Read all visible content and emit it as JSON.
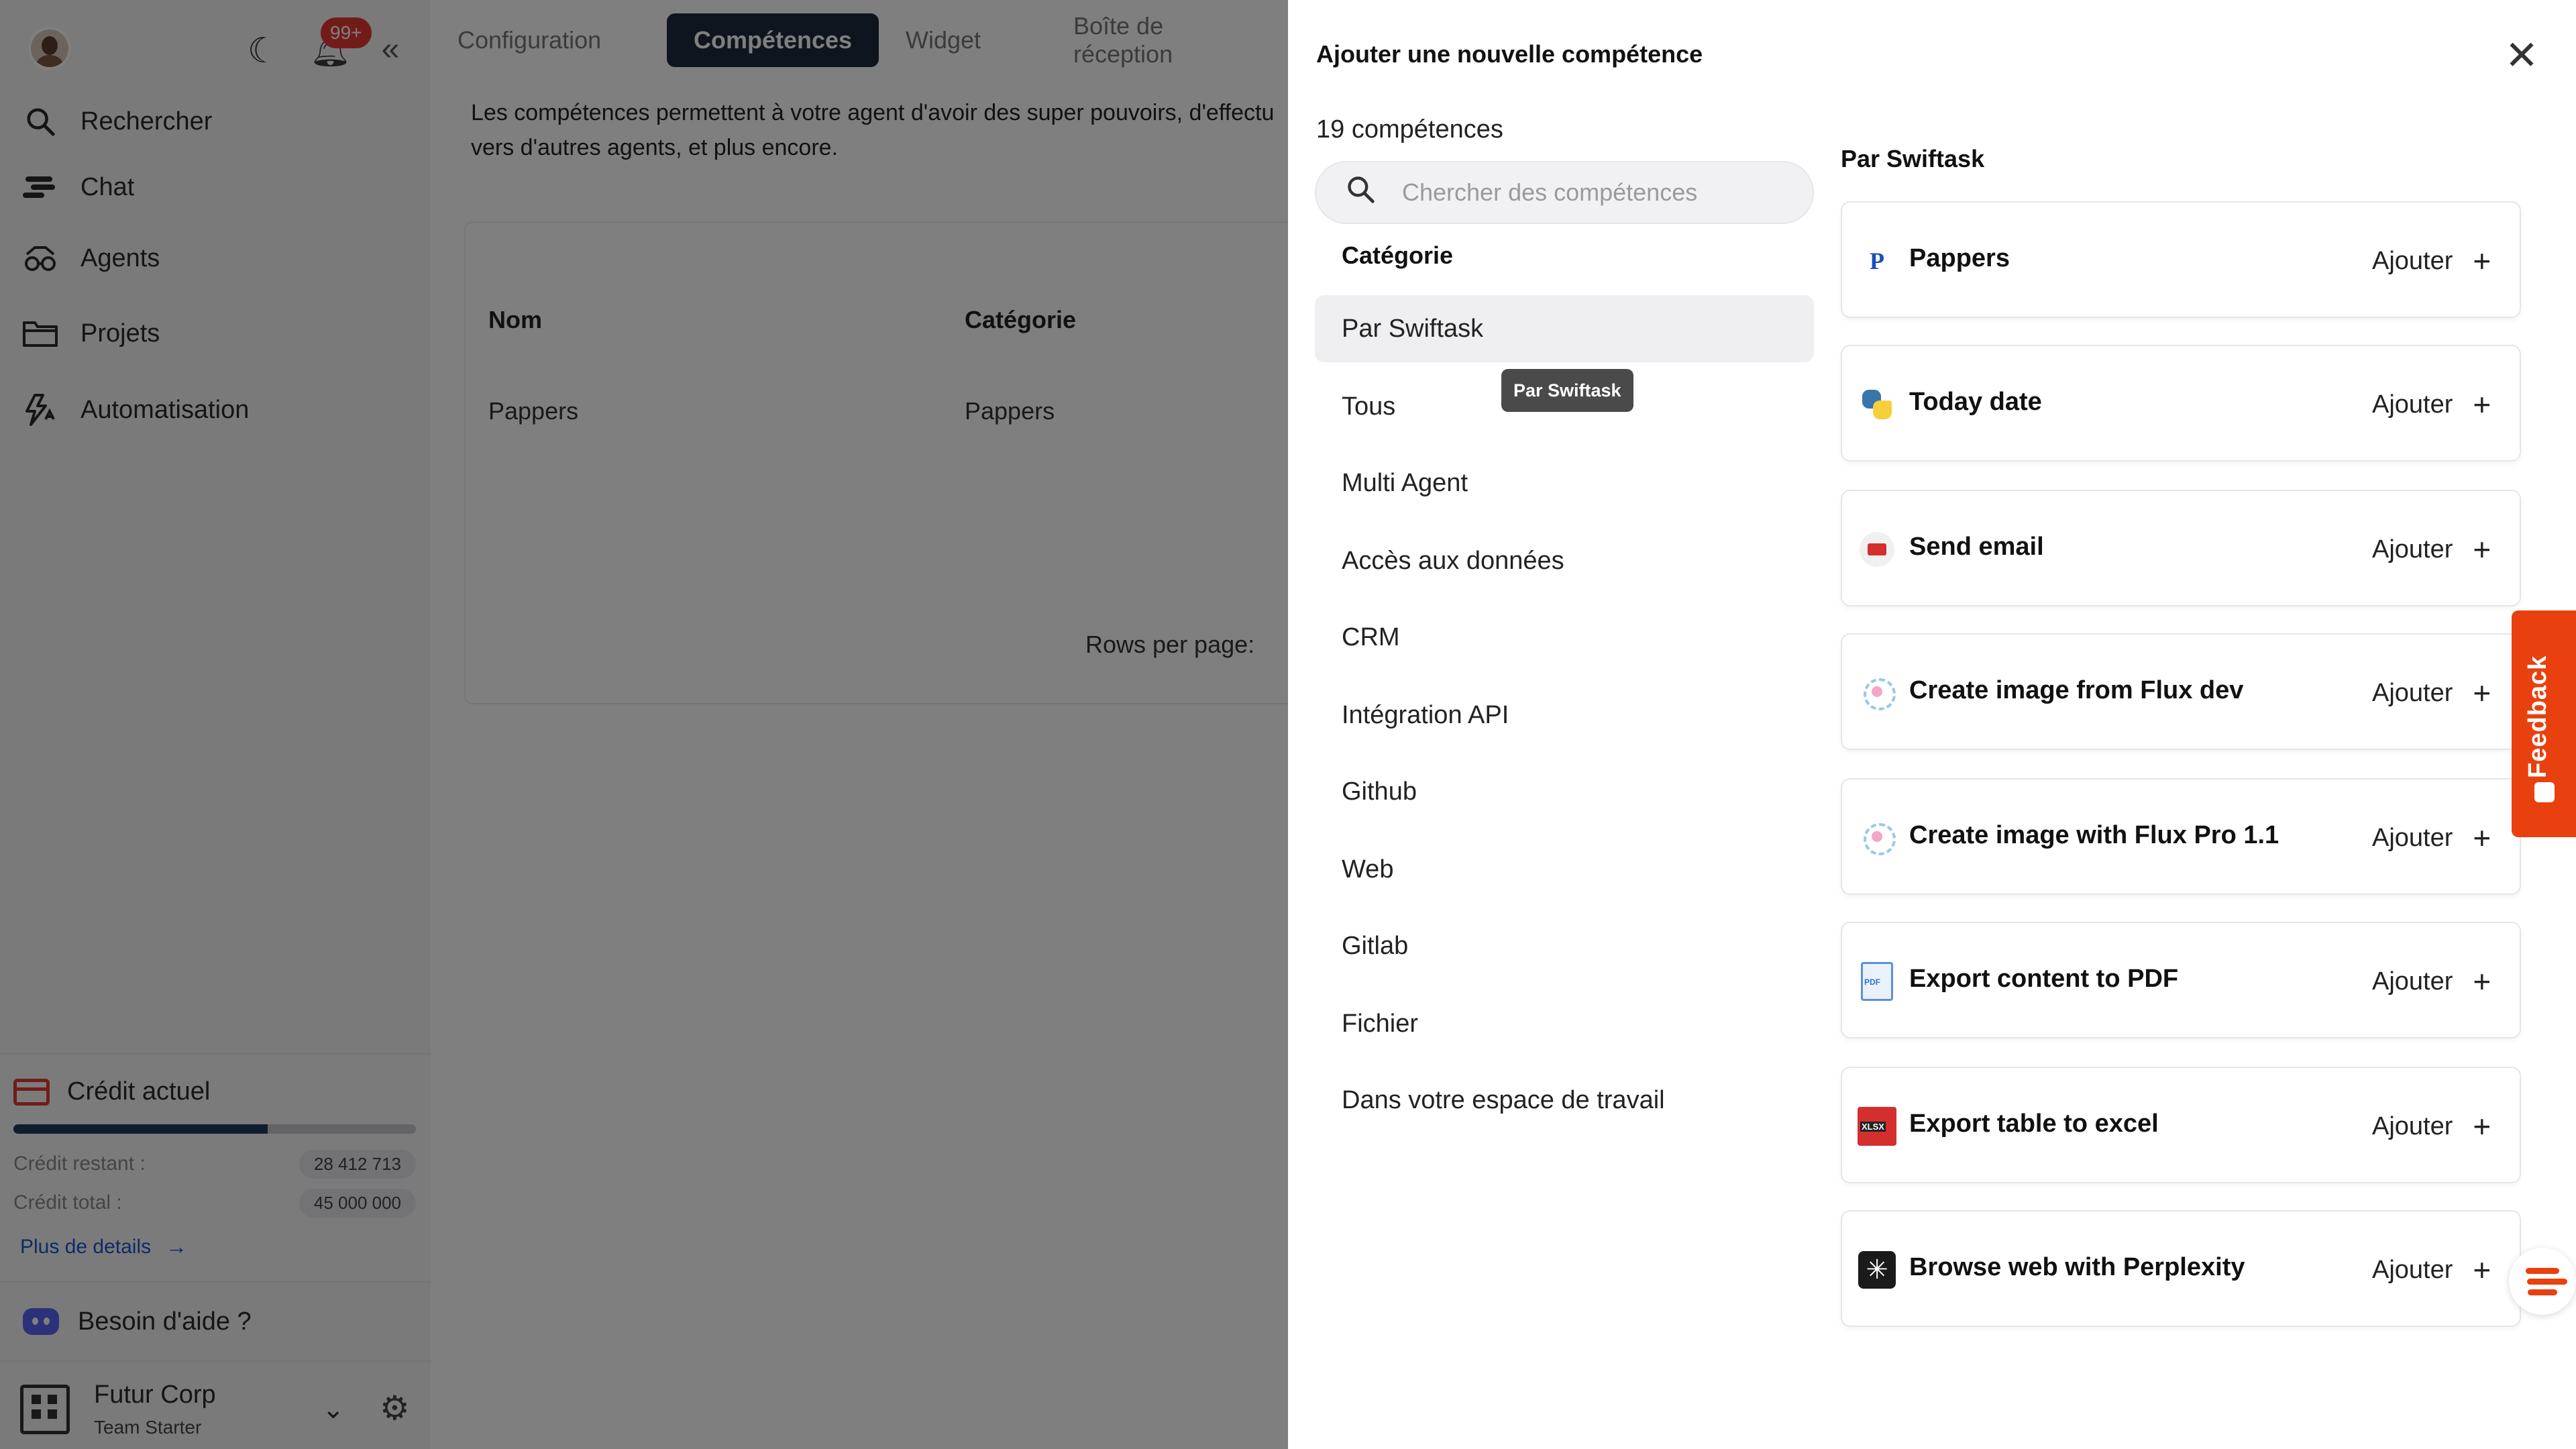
{
  "sidebar": {
    "notifications_badge": "99+",
    "nav": [
      {
        "label": "Rechercher",
        "icon": "search-icon"
      },
      {
        "label": "Chat",
        "icon": "chat-icon"
      },
      {
        "label": "Agents",
        "icon": "agents-icon"
      },
      {
        "label": "Projets",
        "icon": "folder-icon"
      },
      {
        "label": "Automatisation",
        "icon": "automation-icon"
      }
    ],
    "credit": {
      "title": "Crédit actuel",
      "remaining_label": "Crédit restant :",
      "remaining_value": "28 412 713",
      "total_label": "Crédit total :",
      "total_value": "45 000 000",
      "remaining_fraction": 0.631,
      "details_link": "Plus de details"
    },
    "help": "Besoin d'aide ?",
    "org": {
      "name": "Futur Corp",
      "plan": "Team Starter"
    }
  },
  "main": {
    "tabs": [
      "Configuration",
      "Compétences",
      "Widget",
      "Boîte de réception"
    ],
    "active_tab": "Compétences",
    "description_line1": "Les compétences permettent à votre agent d'avoir des super pouvoirs, d'effectu",
    "description_line2": "vers d'autres agents, et plus encore.",
    "table": {
      "headers": [
        "Nom",
        "Catégorie"
      ],
      "rows": [
        [
          "Pappers",
          "Pappers"
        ]
      ],
      "rows_per_page_label": "Rows per page:"
    }
  },
  "panel": {
    "title": "Ajouter une nouvelle compétence",
    "count": "19 compétences",
    "search_placeholder": "Chercher des compétences",
    "category_heading": "Catégorie",
    "categories": [
      "Par Swiftask",
      "Tous",
      "Multi Agent",
      "Accès aux données",
      "CRM",
      "Intégration API",
      "Github",
      "Web",
      "Gitlab",
      "Fichier",
      "Dans votre espace de travail"
    ],
    "active_category": "Par Swiftask",
    "tooltip": "Par Swiftask",
    "group_title": "Par Swiftask",
    "add_label": "Ajouter",
    "skills": [
      {
        "name": "Pappers",
        "icon": "pappers-icon"
      },
      {
        "name": "Today date",
        "icon": "python-icon"
      },
      {
        "name": "Send email",
        "icon": "email-icon"
      },
      {
        "name": "Create image from Flux dev",
        "icon": "flux-icon"
      },
      {
        "name": "Create image with Flux Pro 1.1",
        "icon": "flux-icon"
      },
      {
        "name": "Export content to PDF",
        "icon": "pdf-icon"
      },
      {
        "name": "Export table to excel",
        "icon": "excel-icon"
      },
      {
        "name": "Browse web with Perplexity",
        "icon": "perplexity-icon"
      }
    ]
  },
  "feedback_label": "Feedback",
  "colors": {
    "accent": "#e8410f",
    "active_tab": "#1e2b3c",
    "link": "#1a56c9",
    "badge": "#e53935"
  }
}
